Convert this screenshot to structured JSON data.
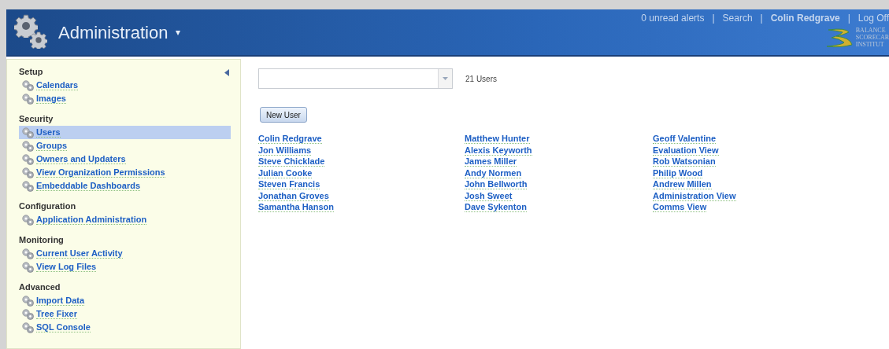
{
  "header": {
    "title": "Administration",
    "caret": "▾",
    "links": [
      {
        "label": "0 unread alerts",
        "bold": false
      },
      {
        "label": "Search",
        "bold": false
      },
      {
        "label": "Colin Redgrave",
        "bold": true
      },
      {
        "label": "Log Off",
        "bold": false
      }
    ],
    "separator": "|",
    "logo_lines": [
      "BALANCE",
      "SCORECAR",
      "INSTITUT"
    ]
  },
  "sidebar": {
    "sections": [
      {
        "heading": "Setup",
        "items": [
          {
            "label": "Calendars",
            "selected": false
          },
          {
            "label": "Images",
            "selected": false
          }
        ]
      },
      {
        "heading": "Security",
        "items": [
          {
            "label": "Users",
            "selected": true
          },
          {
            "label": "Groups",
            "selected": false
          },
          {
            "label": "Owners and Updaters",
            "selected": false
          },
          {
            "label": "View Organization Permissions",
            "selected": false
          },
          {
            "label": "Embeddable Dashboards",
            "selected": false
          }
        ]
      },
      {
        "heading": "Configuration",
        "items": [
          {
            "label": "Application Administration",
            "selected": false
          }
        ]
      },
      {
        "heading": "Monitoring",
        "items": [
          {
            "label": "Current User Activity",
            "selected": false
          },
          {
            "label": "View Log Files",
            "selected": false
          }
        ]
      },
      {
        "heading": "Advanced",
        "items": [
          {
            "label": "Import Data",
            "selected": false
          },
          {
            "label": "Tree Fixer",
            "selected": false
          },
          {
            "label": "SQL Console",
            "selected": false
          }
        ]
      }
    ]
  },
  "content": {
    "user_count": "21 Users",
    "new_user_button": "New User",
    "user_columns": [
      [
        "Colin Redgrave",
        "Jon Williams",
        "Steve Chicklade",
        "Julian Cooke",
        "Steven Francis",
        "Jonathan Groves",
        "Samantha Hanson"
      ],
      [
        "Matthew Hunter",
        "Alexis Keyworth",
        "James Miller",
        "Andy Normen",
        "John Bellworth",
        "Josh Sweet",
        "Dave Sykenton"
      ],
      [
        "Geoff Valentine",
        "Evaluation View",
        "Rob Watsonian",
        "Philip Wood",
        "Andrew Millen",
        "Administration View",
        "Comms View"
      ]
    ]
  }
}
